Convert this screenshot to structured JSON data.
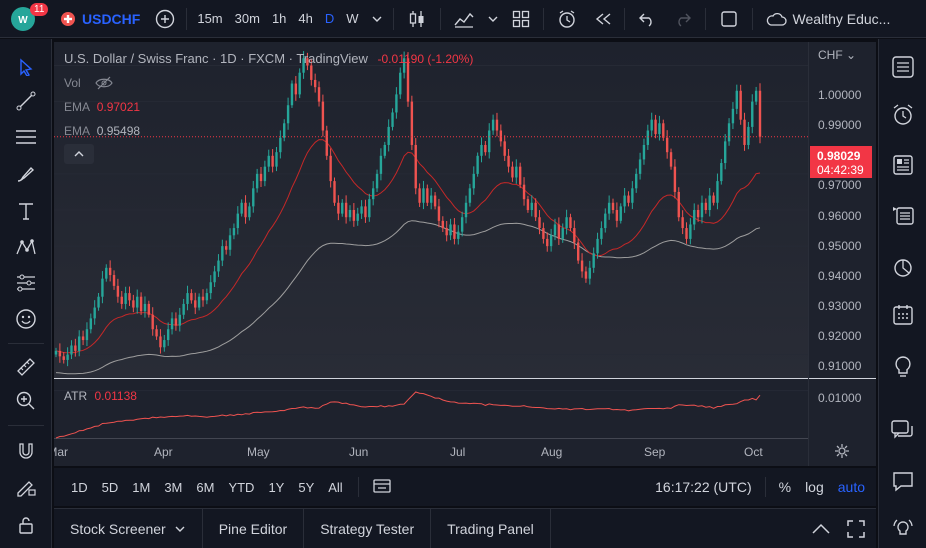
{
  "header": {
    "logo_text": "11",
    "symbol": "USDCHF",
    "timeframes": [
      "15m",
      "30m",
      "1h",
      "4h",
      "D",
      "W"
    ],
    "account": "Wealthy Educ..."
  },
  "legend": {
    "title": "U.S. Dollar / Swiss Franc · 1D · FXCM · TradingView",
    "change": "-0.01190 (-1.20%)",
    "vol": "Vol",
    "ema1_label": "EMA",
    "ema1_value": "0.97021",
    "ema2_label": "EMA",
    "ema2_value": "0.95498"
  },
  "axis": {
    "currency": "CHF",
    "price_labels": [
      "1.00000",
      "0.99000",
      "0.97000",
      "0.96000",
      "0.95000",
      "0.94000",
      "0.93000",
      "0.92000",
      "0.91000"
    ],
    "current_price": "0.98029",
    "countdown": "04:42:39",
    "atr_tick": "0.01000",
    "months": [
      "Mar",
      "Apr",
      "May",
      "Jun",
      "Jul",
      "Aug",
      "Sep",
      "Oct"
    ]
  },
  "atr": {
    "label": "ATR",
    "value": "0.01138"
  },
  "timeframe_bar": {
    "ranges": [
      "1D",
      "5D",
      "1M",
      "3M",
      "6M",
      "YTD",
      "1Y",
      "5Y",
      "All"
    ],
    "clock": "16:17:22 (UTC)",
    "pct": "%",
    "log": "log",
    "auto": "auto"
  },
  "bottom_tabs": [
    "Stock Screener",
    "Pine Editor",
    "Strategy Tester",
    "Trading Panel"
  ],
  "colors": {
    "up": "#26a69a",
    "down": "#ef5350",
    "ema_fast": "#c62828",
    "ema_slow": "#9e9e9e",
    "accent": "#2962ff",
    "price_tag": "#f23645"
  },
  "chart_data": {
    "type": "candlestick",
    "ylim": [
      0.9135,
      1.0065
    ],
    "ema_fast_last": 0.97021,
    "ema_slow_last": 0.95498,
    "last_close": 0.98029,
    "close": [
      0.921,
      0.9195,
      0.9185,
      0.92,
      0.9225,
      0.921,
      0.925,
      0.924,
      0.927,
      0.93,
      0.933,
      0.936,
      0.941,
      0.944,
      0.942,
      0.939,
      0.936,
      0.934,
      0.937,
      0.935,
      0.933,
      0.936,
      0.932,
      0.934,
      0.931,
      0.927,
      0.925,
      0.922,
      0.924,
      0.927,
      0.93,
      0.928,
      0.931,
      0.934,
      0.937,
      0.935,
      0.933,
      0.936,
      0.935,
      0.937,
      0.94,
      0.943,
      0.946,
      0.95,
      0.949,
      0.953,
      0.955,
      0.959,
      0.962,
      0.958,
      0.961,
      0.966,
      0.97,
      0.968,
      0.972,
      0.975,
      0.972,
      0.976,
      0.98,
      0.984,
      0.989,
      0.995,
      0.992,
      0.998,
      1.002,
      1.0,
      0.996,
      0.994,
      0.99,
      0.982,
      0.975,
      0.968,
      0.962,
      0.959,
      0.962,
      0.958,
      0.96,
      0.957,
      0.959,
      0.961,
      0.958,
      0.963,
      0.966,
      0.97,
      0.975,
      0.978,
      0.983,
      0.987,
      0.992,
      0.998,
      1.002,
      0.99,
      0.978,
      0.966,
      0.962,
      0.966,
      0.962,
      0.964,
      0.961,
      0.957,
      0.955,
      0.953,
      0.956,
      0.952,
      0.954,
      0.958,
      0.962,
      0.966,
      0.97,
      0.975,
      0.978,
      0.976,
      0.982,
      0.985,
      0.982,
      0.979,
      0.975,
      0.972,
      0.969,
      0.972,
      0.967,
      0.963,
      0.96,
      0.962,
      0.958,
      0.955,
      0.952,
      0.95,
      0.953,
      0.956,
      0.952,
      0.955,
      0.958,
      0.955,
      0.951,
      0.946,
      0.943,
      0.941,
      0.944,
      0.948,
      0.952,
      0.955,
      0.959,
      0.962,
      0.96,
      0.957,
      0.961,
      0.964,
      0.962,
      0.966,
      0.97,
      0.974,
      0.978,
      0.982,
      0.985,
      0.981,
      0.984,
      0.98,
      0.976,
      0.972,
      0.965,
      0.958,
      0.955,
      0.952,
      0.956,
      0.96,
      0.958,
      0.962,
      0.96,
      0.964,
      0.962,
      0.968,
      0.973,
      0.979,
      0.984,
      0.988,
      0.993,
      0.985,
      0.978,
      0.983,
      0.99,
      0.993,
      0.98029
    ]
  }
}
